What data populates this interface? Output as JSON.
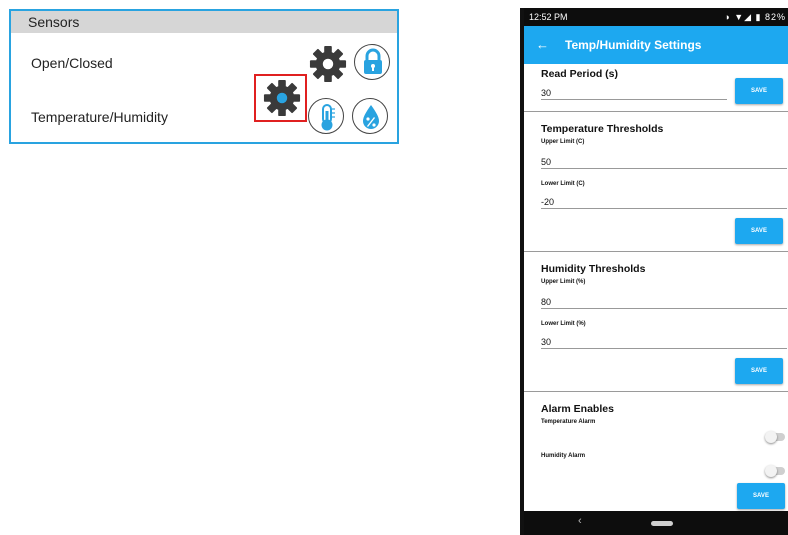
{
  "sensors": {
    "header": "Sensors",
    "rows": [
      {
        "label": "Open/Closed"
      },
      {
        "label": "Temperature/Humidity"
      }
    ],
    "icon_color": "#29a3e0"
  },
  "phone": {
    "status": {
      "time": "12:52 PM",
      "icons": "◑ ▼◢ ▮ 82%"
    },
    "title": "Temp/Humidity Settings",
    "read_period": {
      "title": "Read Period (s)",
      "value": "30",
      "save": "SAVE"
    },
    "temperature": {
      "title": "Temperature Thresholds",
      "upper_label": "Upper Limit (C)",
      "upper_value": "50",
      "lower_label": "Lower Limit (C)",
      "lower_value": "-20",
      "save": "SAVE"
    },
    "humidity": {
      "title": "Humidity Thresholds",
      "upper_label": "Upper Limit (%)",
      "upper_value": "80",
      "lower_label": "Lower Limit (%)",
      "lower_value": "30",
      "save": "SAVE"
    },
    "alarms": {
      "title": "Alarm Enables",
      "temp_label": "Temperature Alarm",
      "temp_enabled": false,
      "humidity_label": "Humidity Alarm",
      "humidity_enabled": false,
      "save": "SAVE"
    },
    "accent_color": "#1da8f0"
  }
}
